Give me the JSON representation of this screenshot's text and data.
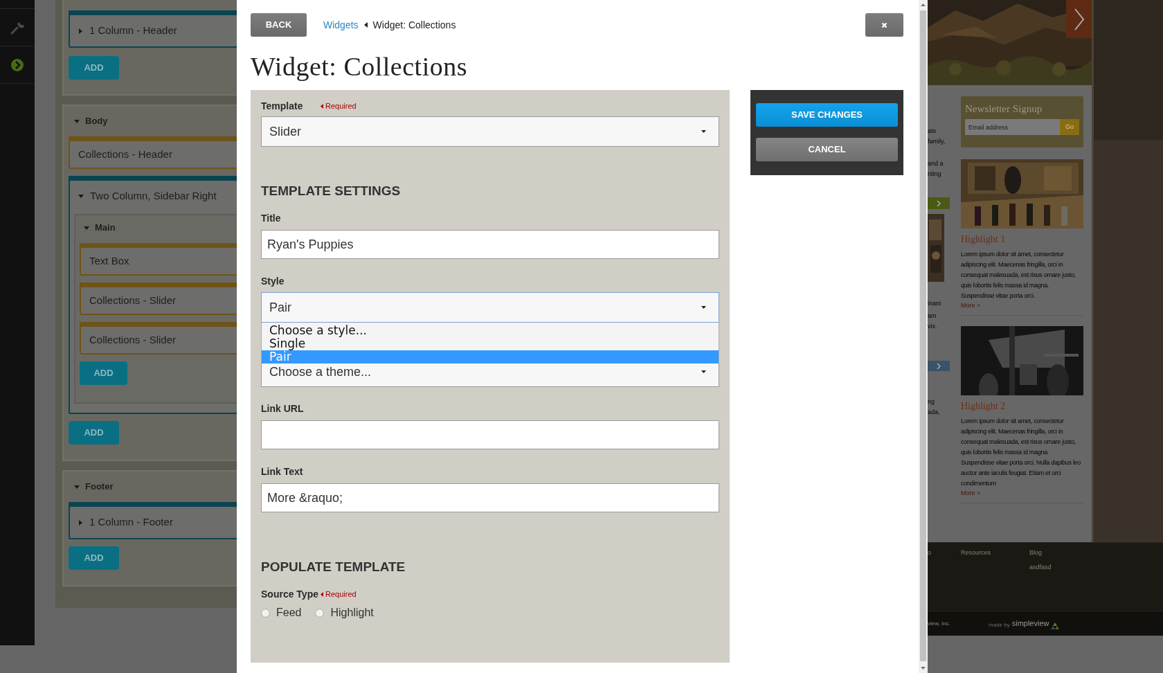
{
  "layout_editor": {
    "sections": [
      {
        "blocks": [
          {
            "kind": "row",
            "label": "1 Column - Header",
            "expanded": false
          }
        ],
        "add_button": "ADD"
      },
      {
        "title": "Body",
        "expanded": true,
        "blocks": [
          {
            "kind": "widget",
            "label": "Collections - Header"
          },
          {
            "kind": "row",
            "label": "Two Column, Sidebar Right",
            "expanded": true,
            "columns": [
              {
                "title": "Main",
                "expanded": true,
                "blocks": [
                  {
                    "kind": "widget",
                    "label": "Text Box"
                  },
                  {
                    "kind": "widget",
                    "label": "Collections - Slider"
                  },
                  {
                    "kind": "widget",
                    "label": "Collections - Slider"
                  }
                ],
                "add_button": "ADD"
              }
            ]
          }
        ],
        "add_button": "ADD"
      },
      {
        "title": "Footer",
        "expanded": true,
        "blocks": [
          {
            "kind": "row",
            "label": "1 Column - Footer",
            "expanded": false
          }
        ],
        "add_button": "ADD"
      }
    ]
  },
  "modal": {
    "back_button": "BACK",
    "breadcrumb": [
      {
        "kind": "link",
        "label": "Widgets"
      },
      {
        "kind": "current",
        "label": "Widget: Collections"
      }
    ],
    "title": "Widget: Collections",
    "form": {
      "template": {
        "label": "Template",
        "required": "Required",
        "value": "Slider"
      },
      "settings_heading": "TEMPLATE SETTINGS",
      "title_field": {
        "label": "Title",
        "value": "Ryan's Puppies"
      },
      "style_field": {
        "label": "Style",
        "value": "Pair",
        "open": true,
        "options": [
          {
            "label": "Choose a style...",
            "selected": false
          },
          {
            "label": "Single",
            "selected": false
          },
          {
            "label": "Pair",
            "selected": true
          }
        ]
      },
      "theme_field": {
        "value": "Choose a theme..."
      },
      "link_url_field": {
        "label": "Link URL"
      },
      "link_text_field": {
        "label": "Link Text",
        "value": "More &raquo;"
      },
      "populate_heading": "POPULATE TEMPLATE",
      "source_type": {
        "label": "Source Type",
        "required": "Required",
        "options": [
          {
            "label": "Feed",
            "selected": false
          },
          {
            "label": "Highlight",
            "selected": false
          }
        ]
      }
    },
    "actions": {
      "save_button": "SAVE CHANGES",
      "cancel_button": "CANCEL"
    }
  },
  "background_site": {
    "fragments": [
      "ats",
      "family,",
      "and a",
      "nting",
      "inani",
      "am",
      "vix.",
      "ng",
      "ada,"
    ],
    "newsletter": {
      "title": "Newsletter Signup",
      "placeholder": "Email address",
      "button": "Go"
    },
    "highlights": [
      {
        "title": "Highlight 1",
        "text": "Lorem ipsum dolor sit amet, consectetur adipiscing elit. Maecenas fringilla, orci in consequat malesuada, est risus ornare justo, quis lobortis felis massa id magna. Suspendisse vitae porta orci.",
        "more": "More »"
      },
      {
        "title": "Highlight 2",
        "text": "Lorem ipsum dolor sit amet, consectetur adipiscing elit. Maecenas fringilla, orci in consequat malesuada, est risus ornare justo, quis lobortis felis massa id magna. Suspendisse vitae porta orci. Nulla dapibus leo auctor ante iaculis feugiat. Etiam et orci condimentum",
        "more": "More »"
      }
    ],
    "footer_links": [
      "o",
      "Resources",
      "Blog",
      "asdfasd"
    ],
    "copyright": "view, Inc.",
    "made_by": "made by",
    "brand": "simpleview"
  }
}
